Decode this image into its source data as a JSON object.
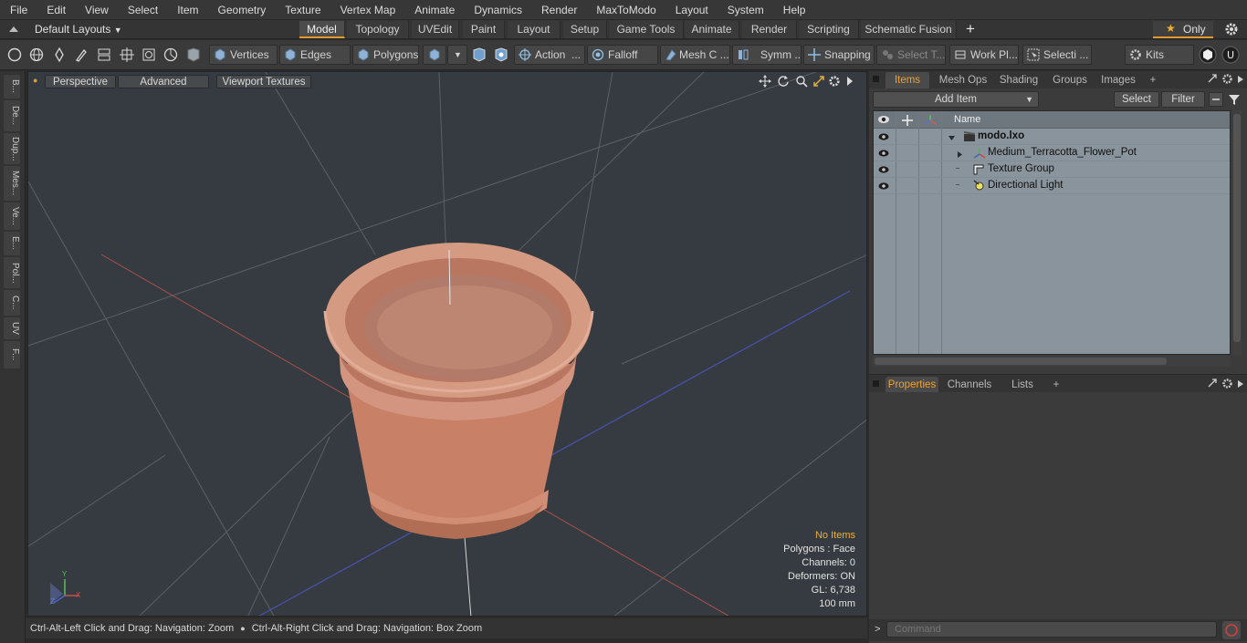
{
  "menu": [
    "File",
    "Edit",
    "View",
    "Select",
    "Item",
    "Geometry",
    "Texture",
    "Vertex Map",
    "Animate",
    "Dynamics",
    "Render",
    "MaxToModo",
    "Layout",
    "System",
    "Help"
  ],
  "layout_bar": {
    "preset": "Default Layouts",
    "tabs": [
      "Model",
      "Topology",
      "UVEdit",
      "Paint",
      "Layout",
      "Setup",
      "Game Tools",
      "Animate",
      "Render",
      "Scripting",
      "Schematic Fusion"
    ],
    "active_tab": "Model",
    "plus": "+",
    "only_label": "Only"
  },
  "toolbar": {
    "vertices": "Vertices",
    "edges": "Edges",
    "polygons": "Polygons",
    "action": "Action",
    "action_more": "...",
    "falloff": "Falloff",
    "mesh": "Mesh C ...",
    "symm": "Symm ...",
    "snapping": "Snapping",
    "select_t": "Select T...",
    "work_pl": "Work Pl...",
    "selecti": "Selecti ...",
    "kits": "Kits"
  },
  "left_strip": [
    "B...",
    "De...",
    "Dup...",
    "Mes...",
    "Ve...",
    "E...",
    "Pol...",
    "C...",
    "UV",
    "F..."
  ],
  "viewport": {
    "perspective": "Perspective",
    "advanced": "Advanced",
    "viewport_textures": "Viewport Textures",
    "info": {
      "items": "No Items",
      "polygons": "Polygons : Face",
      "channels": "Channels: 0",
      "deformers": "Deformers: ON",
      "gl": "GL: 6,738",
      "scale": "100 mm"
    },
    "axis": {
      "x": "X",
      "y": "Y",
      "z": "Z"
    }
  },
  "status_bar": {
    "left": "Ctrl-Alt-Left Click and Drag: Navigation: Zoom",
    "right": "Ctrl-Alt-Right Click and Drag: Navigation: Box Zoom"
  },
  "items_panel": {
    "tabs": [
      "Items",
      "Mesh Ops",
      "Shading",
      "Groups",
      "Images"
    ],
    "active_tab": "Items",
    "plus": "+",
    "add_item": "Add Item",
    "select": "Select",
    "filter": "Filter",
    "column_name": "Name",
    "rows": [
      {
        "name": "modo.lxo",
        "icon": "scene-icon"
      },
      {
        "name": "Medium_Terracotta_Flower_Pot",
        "icon": "mesh-locator-icon"
      },
      {
        "name": "Texture Group",
        "icon": "texture-group-icon"
      },
      {
        "name": "Directional Light",
        "icon": "light-icon"
      }
    ]
  },
  "properties_panel": {
    "tabs": [
      "Properties",
      "Channels",
      "Lists"
    ],
    "active_tab": "Properties",
    "plus": "+"
  },
  "command": {
    "placeholder": "Command"
  },
  "colors": {
    "accent": "#e09a2e",
    "viewport_bg": "#353b40",
    "list_bg": "#8a949c",
    "terracotta": "#c8826a"
  }
}
